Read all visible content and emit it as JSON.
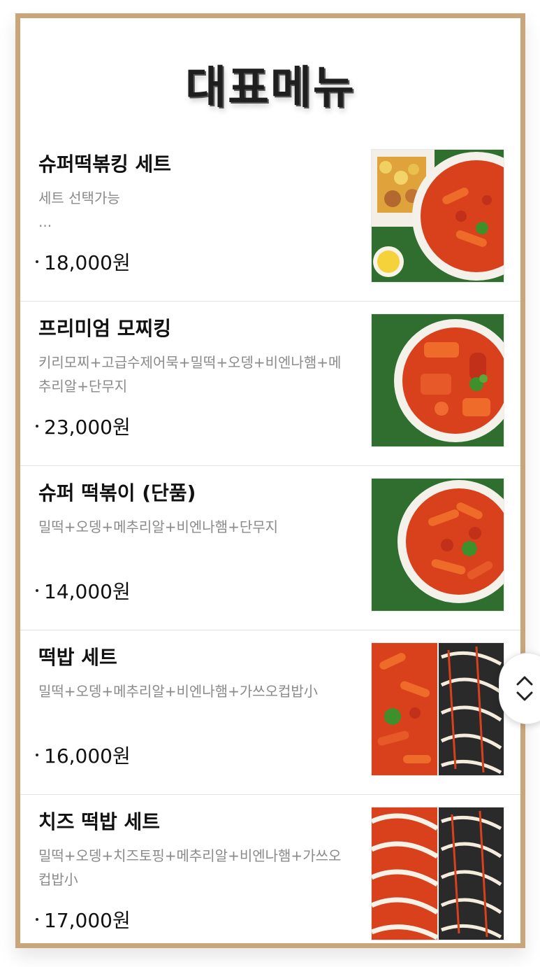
{
  "menu": {
    "title": "대표메뉴",
    "items": [
      {
        "name": "슈퍼떡볶킹 세트",
        "description": "세트 선택가능\n...",
        "price": "18,000원",
        "image_icon": "tteokbokki-with-fries-photo"
      },
      {
        "name": "프리미엄 모찌킹",
        "description": "키리모찌+고급수제어묵+밀떡+오뎅+비엔나햄+메추리알+단무지",
        "price": "23,000원",
        "image_icon": "tteokbokki-bowl-photo"
      },
      {
        "name": "슈퍼 떡볶이 (단품)",
        "description": "밀떡+오뎅+메추리알+비엔나햄+단무지",
        "price": "14,000원",
        "image_icon": "tteokbokki-bowl-photo"
      },
      {
        "name": "떡밥 세트",
        "description": "밀떡+오뎅+메추리알+비엔나햄+가쓰오컵밥小",
        "price": "16,000원",
        "image_icon": "tteokbokki-and-cupbap-photo"
      },
      {
        "name": "치즈 떡밥 세트",
        "description": "밀떡+오뎅+치즈토핑+메추리알+비엔나햄+가쓰오컵밥小",
        "price": "17,000원",
        "image_icon": "cheese-tteokbokki-and-cupbap-photo"
      }
    ]
  },
  "scroll_control": {
    "icon": "chevron-up-down-icon"
  },
  "colors": {
    "frame_border": "#c9a57b",
    "sauce": "#d9411c",
    "grass": "#2f6e2f"
  }
}
